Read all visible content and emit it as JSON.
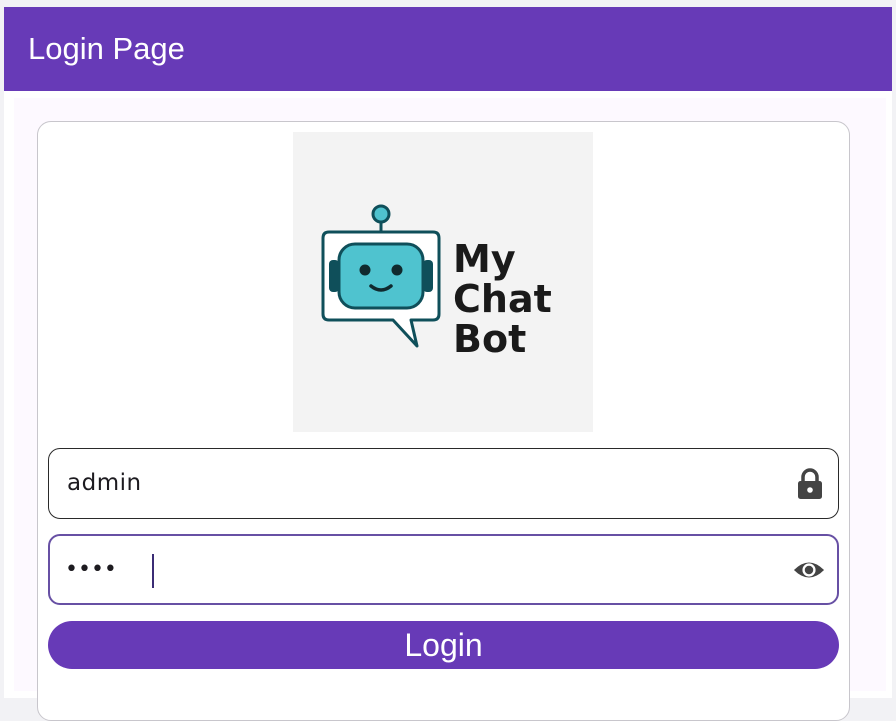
{
  "appbar": {
    "title": "Login Page",
    "color": "#673ab7"
  },
  "logo": {
    "text_line1": "My",
    "text_line2": "Chat",
    "text_line3": "Bot",
    "robot_icon": "robot-icon"
  },
  "username": {
    "value": "admin",
    "icon": "lock-icon"
  },
  "password": {
    "value": "••••",
    "icon": "eye-icon"
  },
  "login_button": {
    "label": "Login"
  },
  "colors": {
    "primary": "#673ab7",
    "focus_border": "#6750a4",
    "robot_face": "#4fc3cf",
    "robot_outline": "#0f4f5a"
  }
}
